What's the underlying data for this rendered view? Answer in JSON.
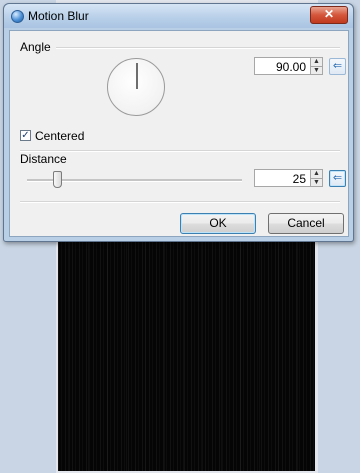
{
  "dialog": {
    "title": "Motion Blur",
    "close_label": "✕"
  },
  "angle": {
    "label": "Angle",
    "value": "90.00",
    "up_arrow": "▲",
    "down_arrow": "▼",
    "reset_glyph": "⇐",
    "dial_degrees": 90
  },
  "centered": {
    "label": "Centered",
    "checked": true,
    "check_glyph": "✓"
  },
  "distance": {
    "label": "Distance",
    "value": "25",
    "up_arrow": "▲",
    "down_arrow": "▼",
    "reset_glyph": "⇐",
    "slider_fraction": 0.125
  },
  "buttons": {
    "ok_label": "OK",
    "cancel_label": "Cancel"
  },
  "icons": {
    "title": "motion-blur-icon",
    "close": "close-icon",
    "reset": "reset-arrow-icon"
  },
  "colors": {
    "accent": "#3c7fb1",
    "image_background": "#050505"
  }
}
